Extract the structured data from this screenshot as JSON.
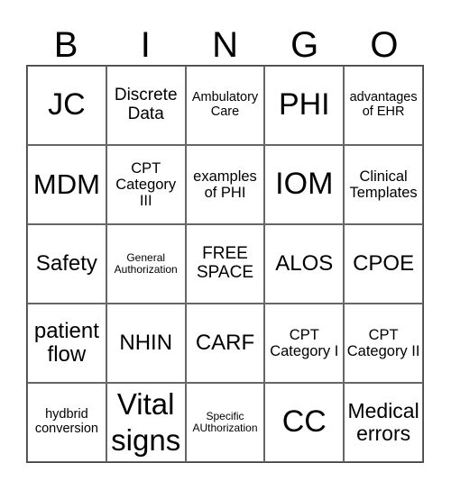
{
  "header": [
    "B",
    "I",
    "N",
    "G",
    "O"
  ],
  "cells": [
    "JC",
    "Discrete Data",
    "Ambulatory Care",
    "PHI",
    "advantages of EHR",
    "MDM",
    "CPT Category III",
    "examples of PHI",
    "IOM",
    "Clinical Templates",
    "Safety",
    "General Authorization",
    "FREE SPACE",
    "ALOS",
    "CPOE",
    "patient flow",
    "NHIN",
    "CARF",
    "CPT Category I",
    "CPT Category II",
    "hydbrid conversion",
    "Vital signs",
    "Specific AUthorization",
    "CC",
    "Medical errors"
  ]
}
